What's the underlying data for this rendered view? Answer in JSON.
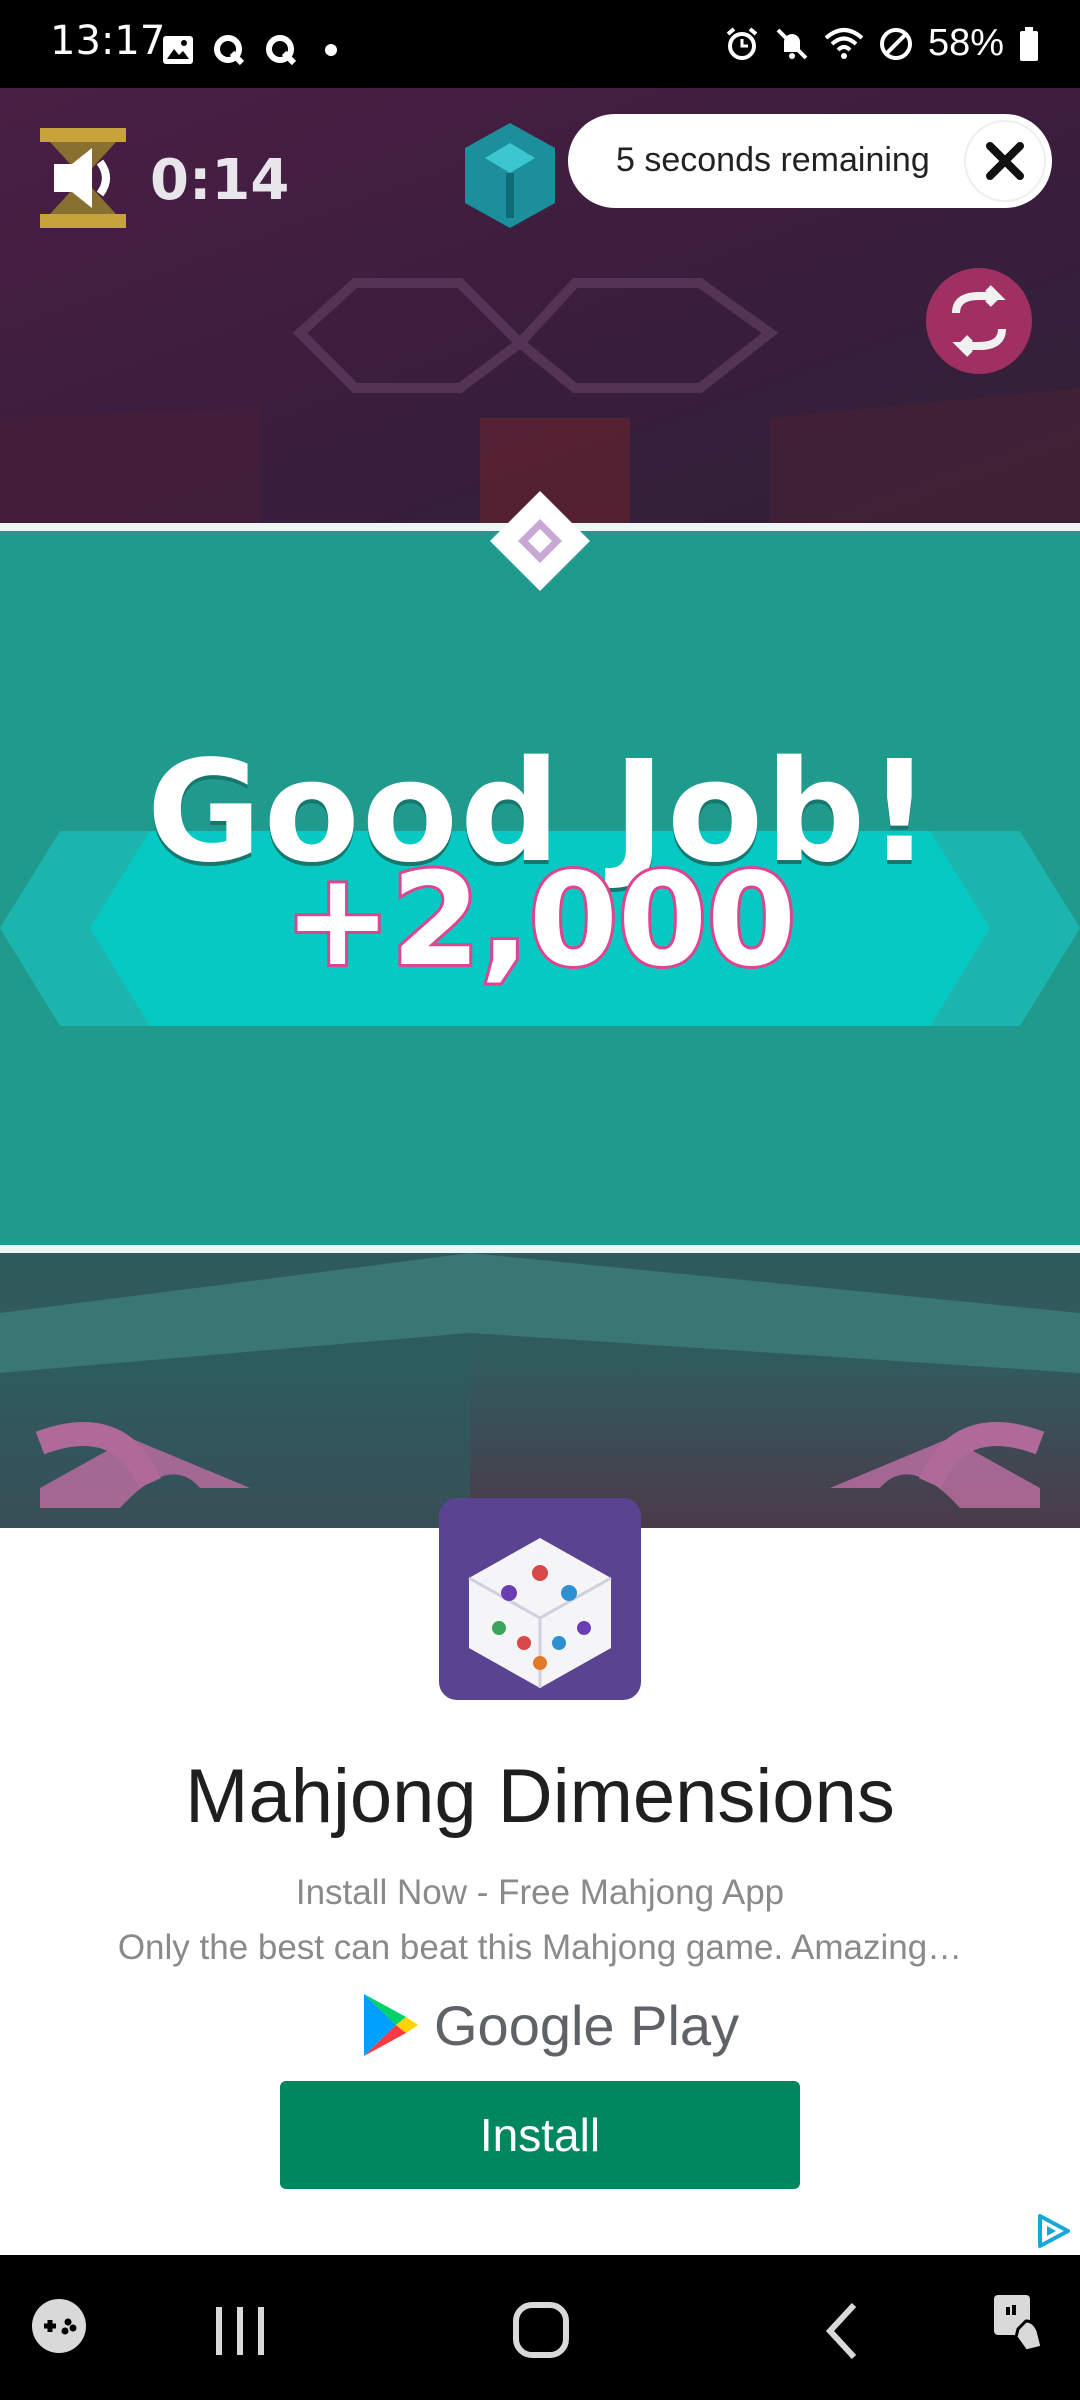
{
  "status_bar": {
    "time": "13:17",
    "left_icons": [
      "image-icon",
      "q-icon",
      "q-icon",
      "dot-icon"
    ],
    "right_icons": [
      "alarm-icon",
      "mute-icon",
      "wifi-icon",
      "dnd-icon"
    ],
    "battery": "58%"
  },
  "game": {
    "timer": "0:14",
    "headline": "Good Job!",
    "score": "+2,000",
    "countdown": "5 seconds remaining",
    "colors": {
      "banner": "#1f9a8d",
      "score_outline": "#e0438f",
      "backdrop": "#3f1e3e"
    }
  },
  "ad": {
    "app_name": "Mahjong Dimensions",
    "subtitle": "Install Now - Free Mahjong App",
    "description": "Only the best can beat this Mahjong game. Amazing…",
    "store": "Google Play",
    "install_label": "Install",
    "install_color": "#01875f"
  },
  "nav": {
    "buttons": [
      "game-launcher-icon",
      "recents-icon",
      "home-icon",
      "back-icon",
      "accessibility-icon"
    ]
  }
}
